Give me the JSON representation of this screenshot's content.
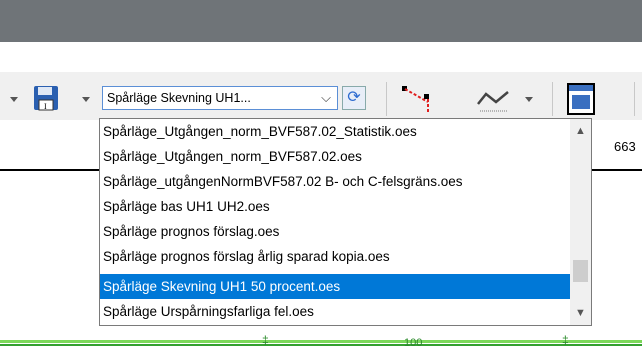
{
  "toolbar": {
    "combo_value": "Spårläge Skevning UH1...",
    "combo_chevron": "⌵",
    "refresh_glyph": "⟳"
  },
  "ruler": {
    "value": "663"
  },
  "track": {
    "label": "100"
  },
  "dropdown": {
    "items": [
      "Spårläge_Utgången_norm_BVF587.02_Statistik.oes",
      "Spårläge_Utgången_norm_BVF587.02.oes",
      "Spårläge_utgångenNormBVF587.02 B- och C-felsgräns.oes",
      "Spårläge bas UH1 UH2.oes",
      "Spårläge prognos förslag.oes",
      "Spårläge prognos förslag årlig sparad kopia.oes",
      "Spårläge Skevning UH1 50 procent.oes",
      "Spårläge Urspårningsfarliga fel.oes"
    ],
    "selected_index": 6,
    "scroll_up": "▲",
    "scroll_down": "▼"
  },
  "colors": {
    "selection": "#0078d7",
    "titlebar": "#6f7478",
    "track_green": "#34a030"
  }
}
